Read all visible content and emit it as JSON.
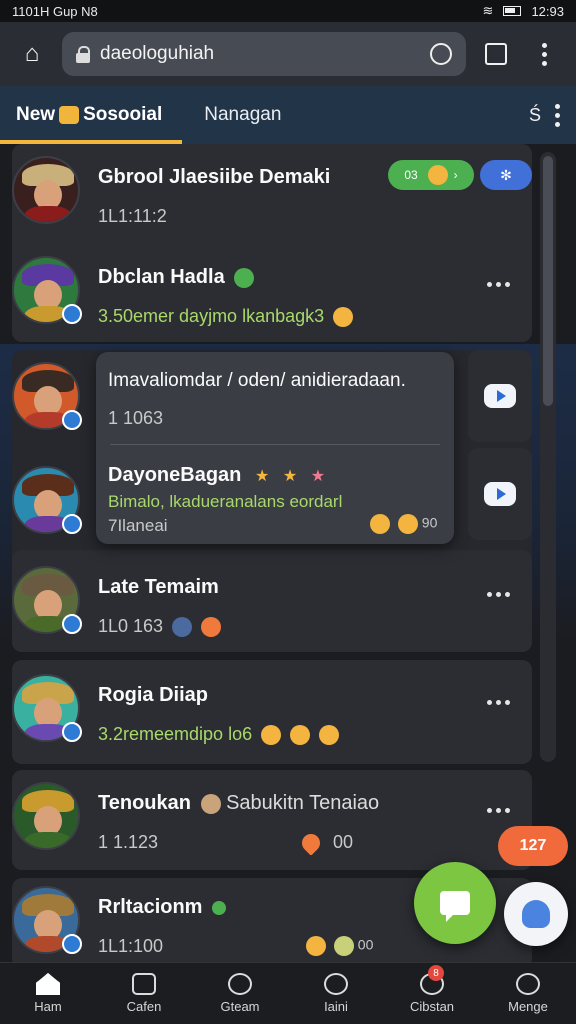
{
  "status_bar": {
    "left": "1101H Gup N8",
    "time": "12:93"
  },
  "browser": {
    "url": "daeologuhiah"
  },
  "tabs": {
    "active": "New",
    "active_suffix": "Sosooial",
    "second": "Nanagan",
    "tail": "Ś"
  },
  "conversations": [
    {
      "name": "Gbrool Jlaesiibe Demaki",
      "meta": "1L1:11:2",
      "pill_green": "03",
      "colors": {
        "hat": "#c9b07a",
        "body": "#8a1c1c"
      }
    },
    {
      "name": "Dbclan Hadla",
      "meta": "3.50emer dayjmo lkanbagk3",
      "colors": {
        "hat": "#5a3aa0",
        "body": "#c99b2e"
      }
    },
    {
      "name": "Imavaliomdar / oden/ anidieradaan.",
      "meta": "1 1063",
      "colors": {
        "hat": "#3a2a24",
        "body": "#b43a2a"
      }
    },
    {
      "name": "DayoneBagan",
      "meta": "Bimalo, lkadueranalans eordarl",
      "meta2": "7Ilaneai",
      "count": "90",
      "colors": {
        "hat": "#5a2e1a",
        "body": "#6a3a9a"
      }
    },
    {
      "name": "Late Temaim",
      "meta": "1L0 163",
      "colors": {
        "hat": "#6b5a42",
        "body": "#4a6a2a"
      }
    },
    {
      "name": "Rogia Diiap",
      "meta": "3.2remeemdipo lo6",
      "colors": {
        "hat": "#c9a44a",
        "body": "#6a4ab0"
      }
    },
    {
      "name": "Tenoukan",
      "name_suffix": "Sabukitn Tenaiao",
      "meta": "1 1.123",
      "count": "00",
      "colors": {
        "hat": "#c99b2e",
        "body": "#3a6a2a"
      }
    },
    {
      "name": "Rrltacionm",
      "meta": "1L1:100",
      "count": "00",
      "colors": {
        "hat": "#a07a3a",
        "body": "#b04a2a"
      }
    }
  ],
  "badge_orange": "127",
  "bottom_nav": [
    {
      "label": "Ham",
      "icon": "home-icon"
    },
    {
      "label": "Cafen",
      "icon": "compose-icon"
    },
    {
      "label": "Gteam",
      "icon": "camera-icon"
    },
    {
      "label": "Iaini",
      "icon": "search-icon"
    },
    {
      "label": "Cibstan",
      "icon": "alerts-icon",
      "badge": "8"
    },
    {
      "label": "Menge",
      "icon": "profile-icon"
    }
  ]
}
